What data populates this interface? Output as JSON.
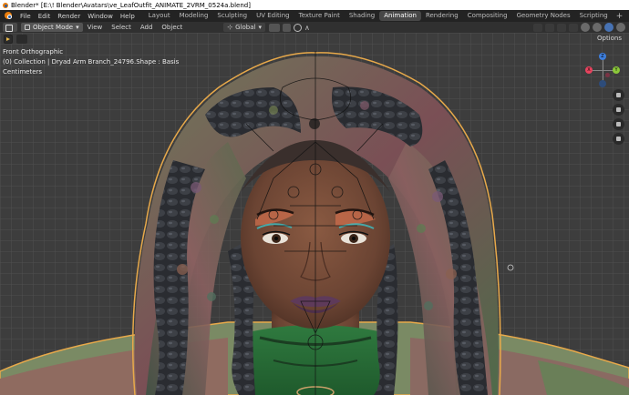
{
  "window": {
    "title": "Blender* [E:\\! Blender\\Avatars\\ve_LeafOutfit_ANIMATE_2VRM_0524a.blend]"
  },
  "topbar": {
    "menus": [
      "File",
      "Edit",
      "Render",
      "Window",
      "Help"
    ],
    "workspaces": [
      "Layout",
      "Modeling",
      "Sculpting",
      "UV Editing",
      "Texture Paint",
      "Shading",
      "Animation",
      "Rendering",
      "Compositing",
      "Geometry Nodes",
      "Scripting"
    ],
    "active_workspace": "Animation",
    "add_tab": "+"
  },
  "viewport_header": {
    "mode": "Object Mode",
    "menus": [
      "View",
      "Select",
      "Add",
      "Object"
    ],
    "orientation": "Global",
    "options": "Options"
  },
  "viewport": {
    "view_name": "Front Orthographic",
    "collection_line": "(0) Collection | Dryad Arm Branch_24796.Shape : Basis",
    "units": "Centimeters"
  },
  "gizmo": {
    "x": "X",
    "y": "Y",
    "z": "Z"
  },
  "colors": {
    "accent_orange": "#e87d0d",
    "active_tab_bg": "#474747",
    "selection_outline": "#e8a94a"
  }
}
